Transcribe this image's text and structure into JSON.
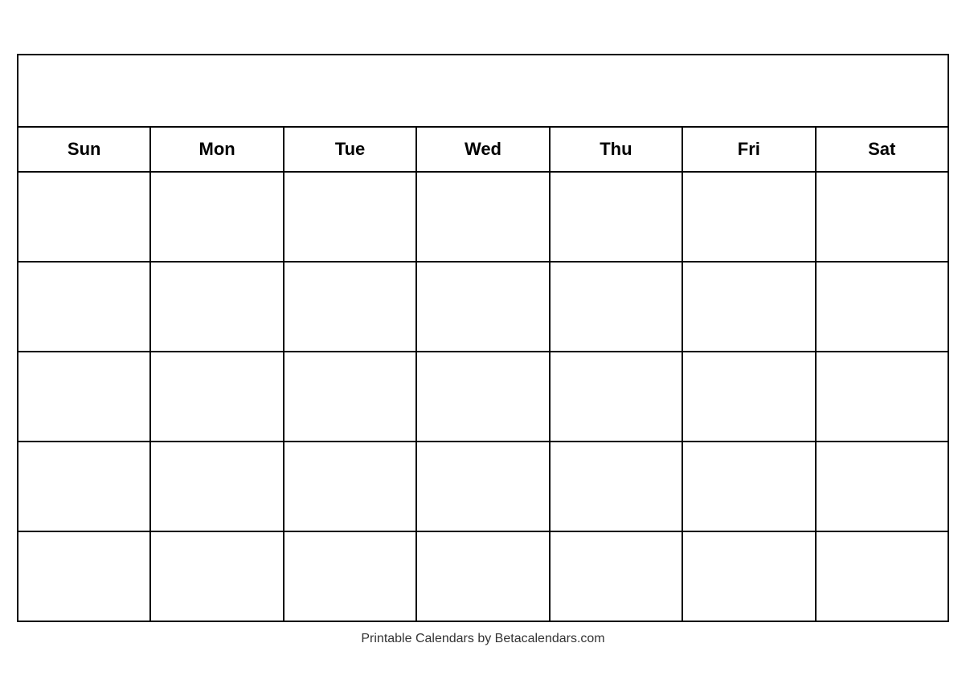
{
  "calendar": {
    "title": "",
    "days": [
      "Sun",
      "Mon",
      "Tue",
      "Wed",
      "Thu",
      "Fri",
      "Sat"
    ],
    "rows": 5
  },
  "footer": {
    "text": "Printable Calendars by Betacalendars.com"
  }
}
